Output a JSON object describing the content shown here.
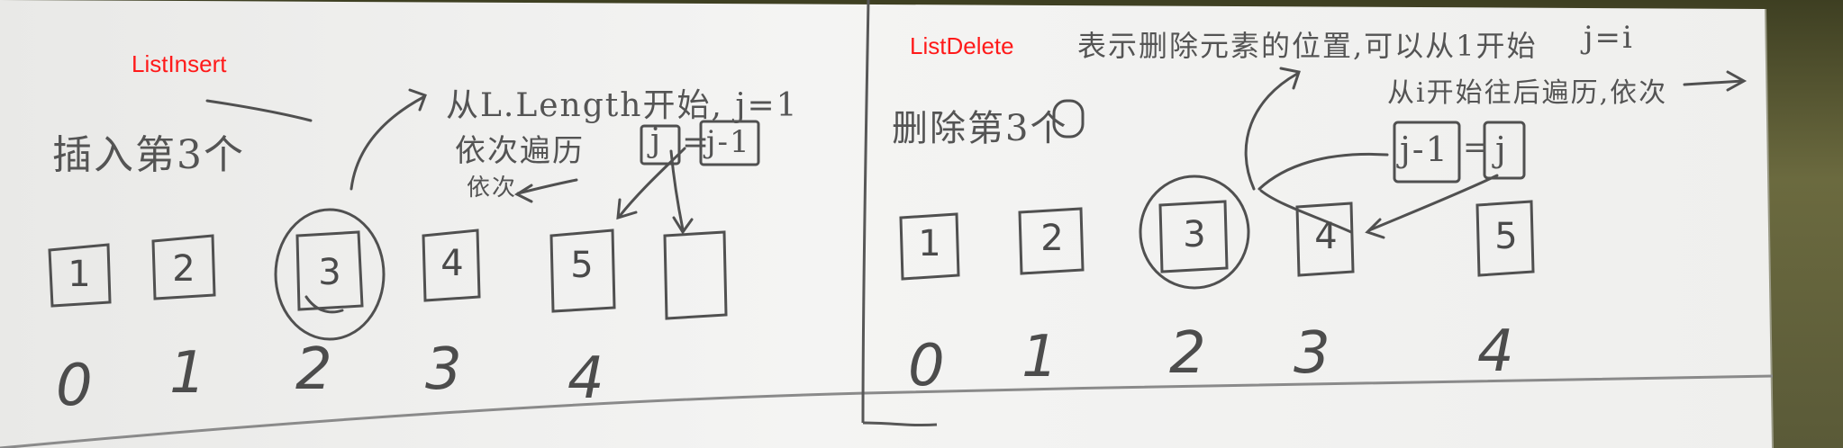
{
  "labels": {
    "left_title": "ListInsert",
    "right_title": "ListDelete"
  },
  "insert": {
    "heading": "插入第3个",
    "note_line1": "从L.Length开始, j=1",
    "note_line2": "依次遍历",
    "note_line3": "依次",
    "formula_left": "j",
    "formula_right": "j-1",
    "values": [
      "1",
      "2",
      "3",
      "4",
      "5"
    ],
    "indices": [
      "0",
      "1",
      "2",
      "3",
      "4"
    ],
    "highlighted_index": 2
  },
  "delete": {
    "heading": "删除第3个",
    "heading_num": "3",
    "note_top": "表示删除元素的位置,可以从1开始",
    "note_j": "j=i",
    "note_line2": "从i开始往后遍历,依次",
    "formula_left": "j-1",
    "formula_right": "j",
    "values": [
      "1",
      "2",
      "3",
      "4",
      "5"
    ],
    "indices": [
      "0",
      "1",
      "2",
      "3",
      "4"
    ],
    "highlighted_index": 2
  },
  "colors": {
    "paper": "#f3f3f1",
    "pencil": "#505050",
    "label_red": "#ff1a1a",
    "background": "#4a4d2c"
  }
}
